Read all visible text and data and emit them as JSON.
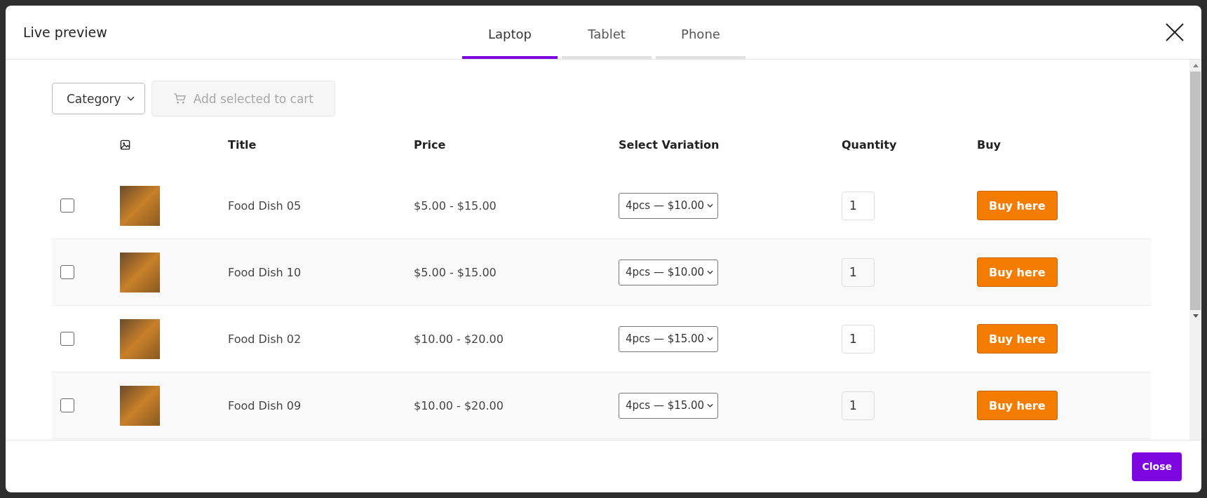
{
  "window": {
    "title": "Live preview"
  },
  "tabs": [
    {
      "label": "Laptop",
      "selected": true
    },
    {
      "label": "Tablet",
      "selected": false
    },
    {
      "label": "Phone",
      "selected": false
    }
  ],
  "toolbar": {
    "category": "Category",
    "add_to_cart": {
      "label": "Add selected to cart",
      "disabled": true
    }
  },
  "table": {
    "columns": [
      "Title",
      "Price",
      "Select Variation",
      "Quantity",
      "Buy"
    ],
    "rows": [
      {
        "checked": false,
        "title": "Food Dish 05",
        "price": "$5.00 - $15.00",
        "variation": "4pcs — $10.00",
        "quantity": "1",
        "buy": "Buy here"
      },
      {
        "checked": false,
        "title": "Food Dish 10",
        "price": "$5.00 - $15.00",
        "variation": "4pcs — $10.00",
        "quantity": "1",
        "buy": "Buy here"
      },
      {
        "checked": false,
        "title": "Food Dish 02",
        "price": "$10.00 - $20.00",
        "variation": "4pcs — $15.00",
        "quantity": "1",
        "buy": "Buy here"
      },
      {
        "checked": false,
        "title": "Food Dish 09",
        "price": "$10.00 - $20.00",
        "variation": "4pcs — $15.00",
        "quantity": "1",
        "buy": "Buy here"
      }
    ]
  },
  "footer": {
    "close": "Close"
  }
}
